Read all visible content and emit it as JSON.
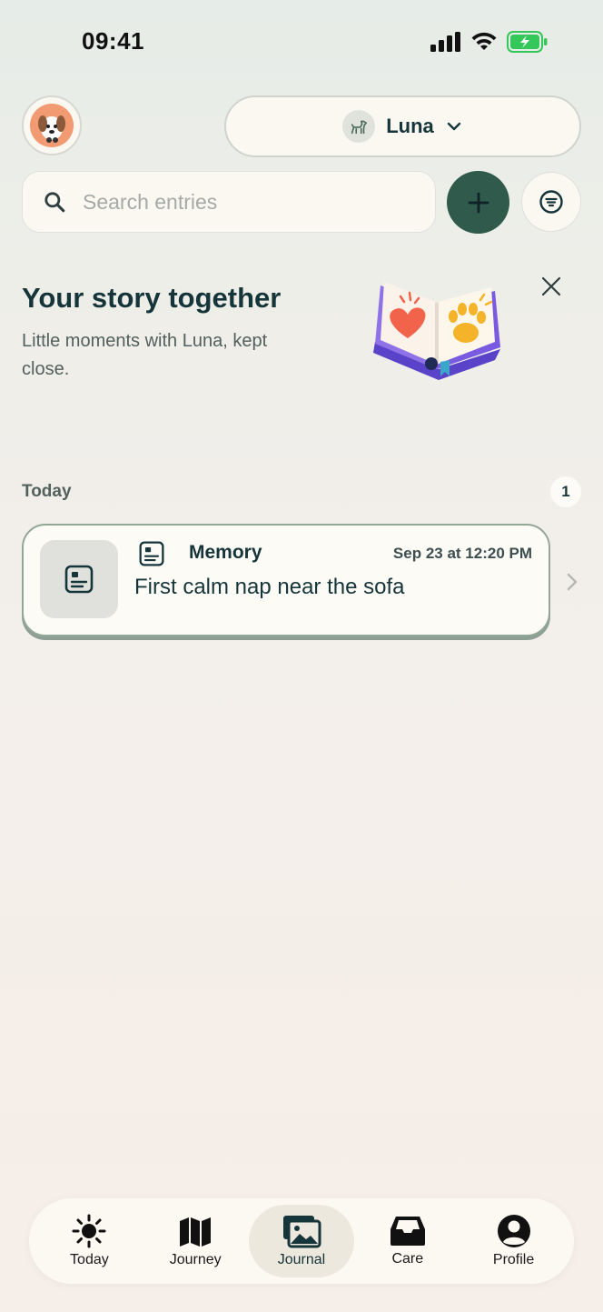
{
  "status": {
    "time": "09:41"
  },
  "header": {
    "pet_name": "Luna"
  },
  "search": {
    "placeholder": "Search entries"
  },
  "banner": {
    "title": "Your story together",
    "subtitle": "Little moments with Luna, kept close."
  },
  "section": {
    "title": "Today",
    "count": "1"
  },
  "entries": [
    {
      "type": "Memory",
      "date": "Sep 23 at 12:20 PM",
      "text": "First calm nap near the sofa"
    }
  ],
  "tabs": [
    {
      "label": "Today",
      "icon": "sun-icon"
    },
    {
      "label": "Journey",
      "icon": "map-icon"
    },
    {
      "label": "Journal",
      "icon": "photos-icon",
      "active": true
    },
    {
      "label": "Care",
      "icon": "inbox-icon"
    },
    {
      "label": "Profile",
      "icon": "person-icon"
    }
  ],
  "colors": {
    "accent": "#2f5a4c",
    "text": "#16353a",
    "battery": "#34c759"
  }
}
